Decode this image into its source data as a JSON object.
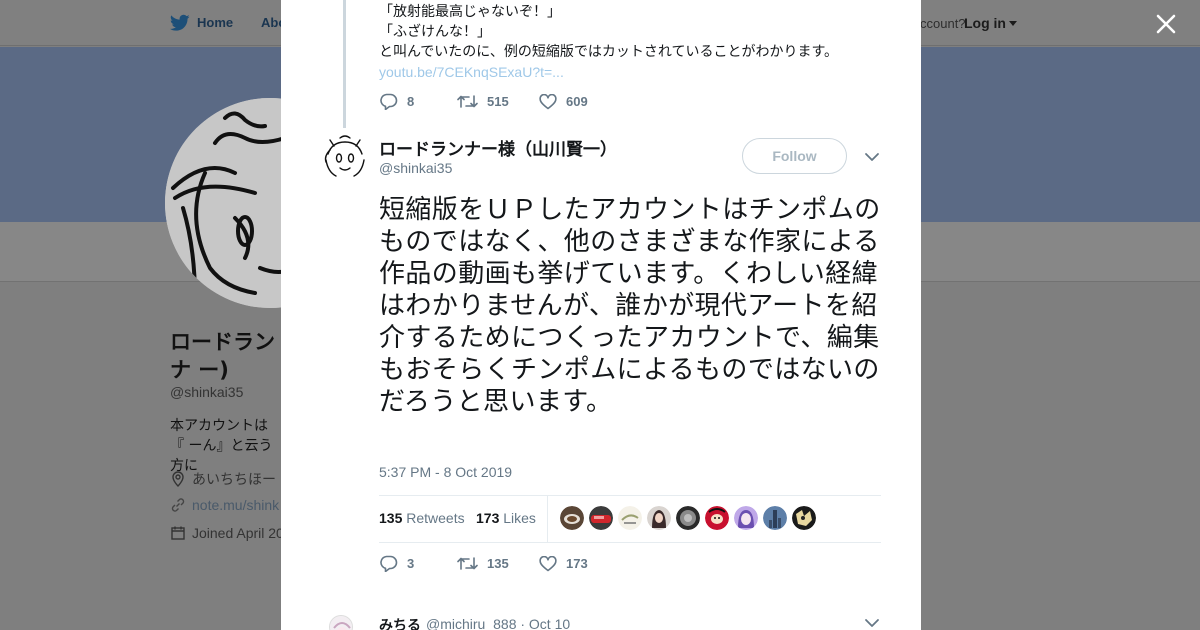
{
  "background_page": {
    "nav": {
      "home_label": "Home",
      "about_label": "Abo",
      "account_question": "ccount?",
      "login_label": "Log in"
    },
    "profile": {
      "name": "ロードランナ ー)",
      "handle": "@shinkai35",
      "bio": "本アカウントは『 ーん』と云う方に",
      "location": "あいちちほー",
      "website": "note.mu/shink",
      "joined": "Joined April 20"
    }
  },
  "modal": {
    "previous_tweet": {
      "lines": [
        "「放射能最高じゃないぞ！」",
        "「ふざけんな！」",
        "と叫んでいたのに、例の短縮版ではカットされていることがわかります。"
      ],
      "link": "youtu.be/7CEKnqSExaU?t=...",
      "replies": "8",
      "retweets": "515",
      "likes": "609"
    },
    "tweet": {
      "author_name": "ロードランナー様（山川賢一）",
      "author_handle": "@shinkai35",
      "follow_label": "Follow",
      "text": "短縮版をＵＰしたアカウントはチンポムのものではなく、他のさまざまな作家による作品の動画も挙げています。くわしい経緯はわかりませんが、誰かが現代アートを紹介するためにつくったアカウントで、編集もおそらくチンポムによるものではないのだろうと思います。",
      "timestamp": "5:37 PM - 8 Oct 2019",
      "retweets_count": "135",
      "retweets_label": "Retweets",
      "likes_count": "173",
      "likes_label": "Likes",
      "reply_count": "3",
      "retweet_action_count": "135",
      "like_action_count": "173"
    },
    "reply": {
      "name": "みちる",
      "meta": "@michiru_888 · Oct 10"
    }
  },
  "colors": {
    "accent": "#1da1f2",
    "icon_gray": "#657786",
    "link_light": "#9fc8e8"
  },
  "likers": [
    "liker-1",
    "liker-2",
    "liker-3",
    "liker-4",
    "liker-5",
    "liker-6",
    "liker-7",
    "liker-8",
    "liker-9"
  ]
}
